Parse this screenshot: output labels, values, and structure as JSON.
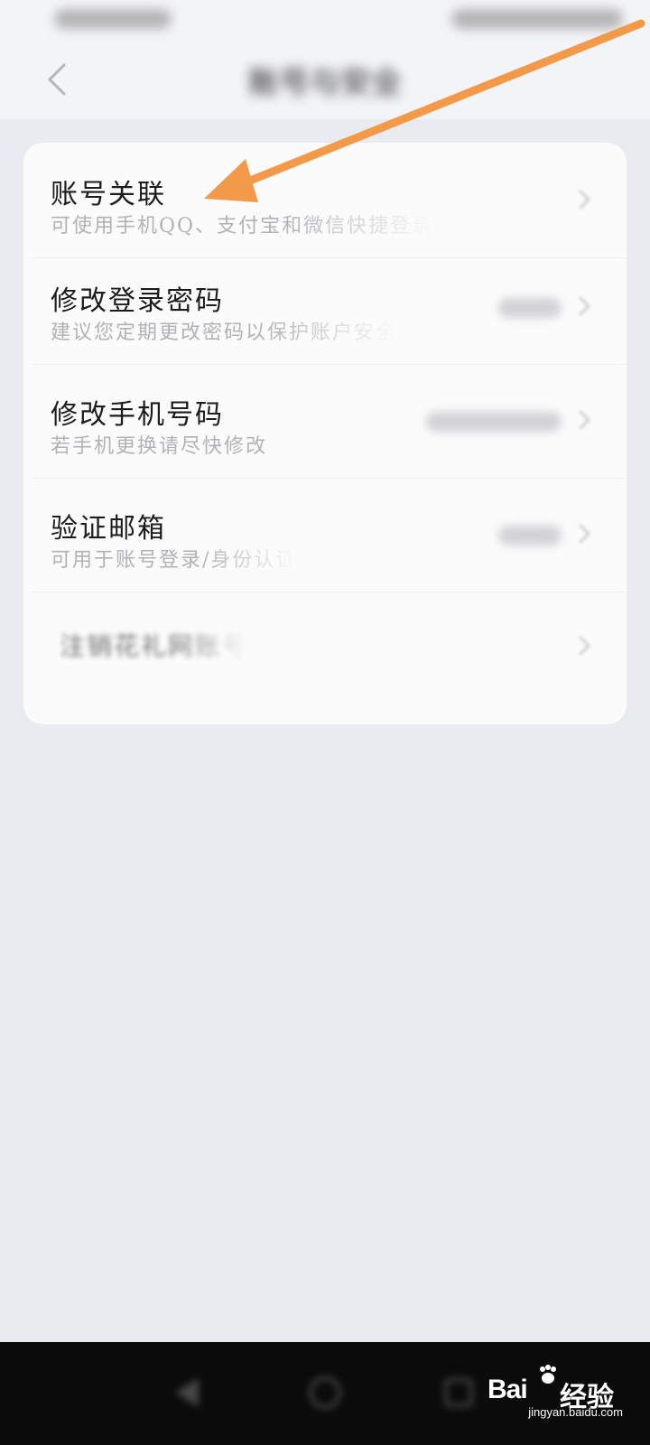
{
  "header": {
    "title": "账号与安全",
    "back_icon": "chevron-left-icon"
  },
  "settings": {
    "items": [
      {
        "title": "账号关联",
        "subtitle": "可使用手机QQ、支付宝和微信快捷登录",
        "value": ""
      },
      {
        "title": "修改登录密码",
        "subtitle": "建议您定期更改密码以保护账户安全",
        "value": ""
      },
      {
        "title": "修改手机号码",
        "subtitle": "若手机更换请尽快修改",
        "value": ""
      },
      {
        "title": "验证邮箱",
        "subtitle": "可用于账号登录/身份认证",
        "value": ""
      }
    ],
    "logout": {
      "title": "注销花礼网账号"
    }
  },
  "annotation": {
    "color": "#f39a4a"
  },
  "watermark": {
    "brand_a": "Bai",
    "brand_b": "经验",
    "url": "jingyan.baidu.com"
  },
  "colors": {
    "background": "#e9ebf0",
    "card": "#fbfbfc",
    "nav_bar": "#0b0b0b"
  }
}
